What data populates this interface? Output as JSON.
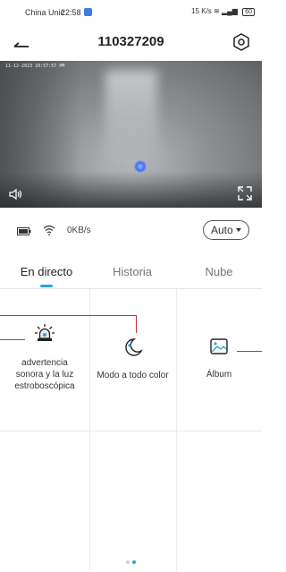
{
  "status_bar": {
    "carrier": "China Unic",
    "time": "22:58",
    "speed_top": "15",
    "speed_unit": "K/s",
    "battery": "60"
  },
  "header": {
    "title": "110327209"
  },
  "video": {
    "timestamp": "11-12-2023 10:57:57 PM"
  },
  "info": {
    "speed": "0KB/s",
    "quality": "Auto"
  },
  "tabs": [
    {
      "label": "En directo"
    },
    {
      "label": "Historia"
    },
    {
      "label": "Nube"
    }
  ],
  "features": [
    {
      "label_line1": "advertencia",
      "label_line2": "sonora y la luz",
      "label_line3": "estroboscópica",
      "icon": "siren-icon"
    },
    {
      "label": "Modo a todo color",
      "icon": "moon-star-icon"
    },
    {
      "label": "Álbum",
      "icon": "image-icon"
    }
  ],
  "colors": {
    "accent": "#2aa3d8",
    "annotation": "#cf2d2d"
  }
}
